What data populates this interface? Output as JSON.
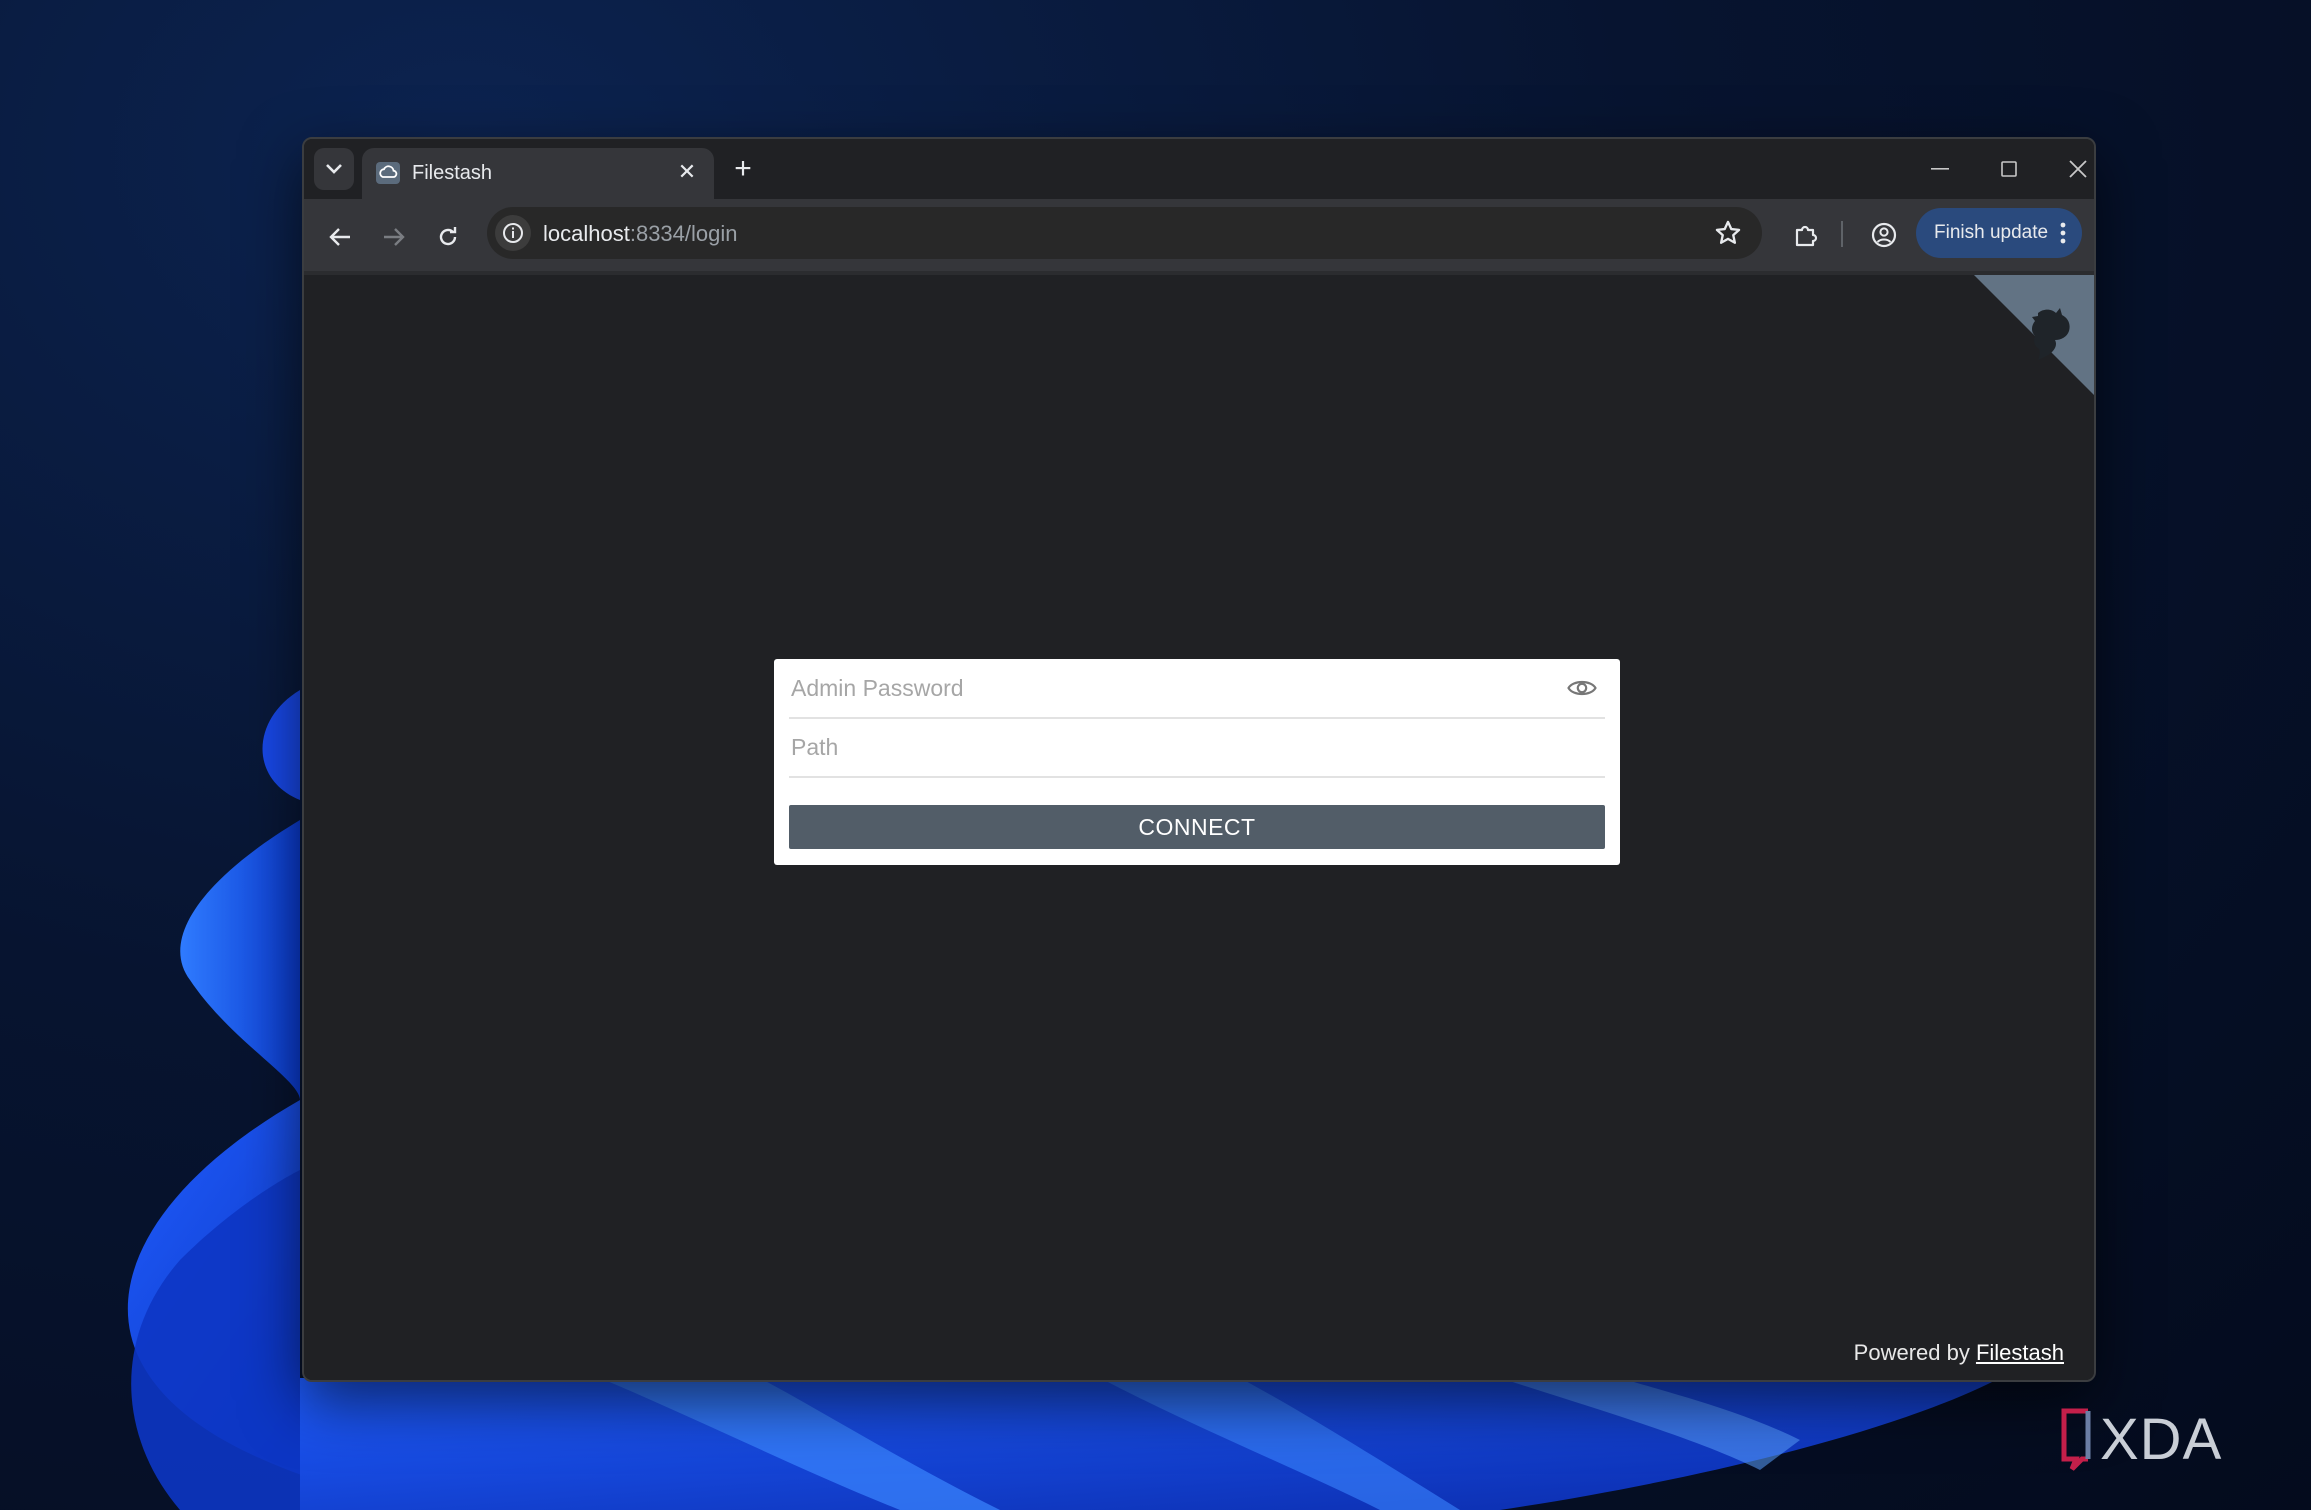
{
  "browser": {
    "tab": {
      "title": "Filestash"
    },
    "address": {
      "host": "localhost",
      "rest": ":8334/login"
    },
    "update_button_label": "Finish update"
  },
  "login": {
    "password_placeholder": "Admin Password",
    "path_placeholder": "Path",
    "connect_label": "CONNECT"
  },
  "footer": {
    "powered_prefix": "Powered by ",
    "powered_link": "Filestash"
  },
  "watermark": {
    "brand": "XDA"
  },
  "colors": {
    "button": "#525d68",
    "update_pill": "#2a4a7d",
    "page_background": "#202124"
  }
}
